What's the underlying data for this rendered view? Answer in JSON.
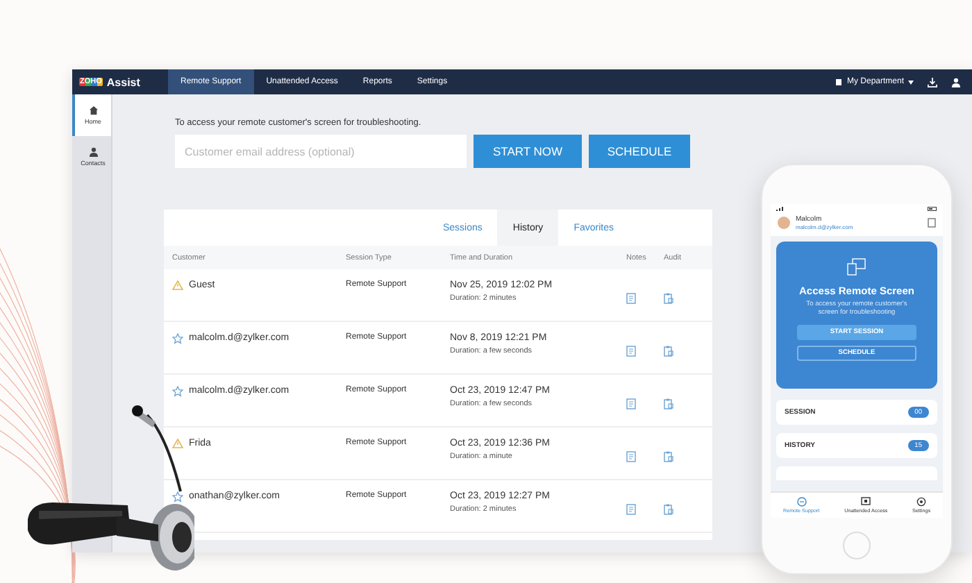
{
  "app": {
    "logo": {
      "brand": "ZOHO",
      "product": "Assist"
    },
    "nav": [
      {
        "label": "Remote Support",
        "selected": true
      },
      {
        "label": "Unattended Access",
        "selected": false
      },
      {
        "label": "Reports",
        "selected": false
      },
      {
        "label": "Settings",
        "selected": false
      }
    ],
    "department": "My Department",
    "sidebar": [
      {
        "label": "Home",
        "selected": true
      },
      {
        "label": "Contacts",
        "selected": false
      }
    ],
    "prompt": "To access your remote customer's screen for troubleshooting.",
    "email_field": {
      "placeholder": "Customer email address (optional)"
    },
    "buttons": [
      "START NOW",
      "SCHEDULE"
    ],
    "tabs": [
      {
        "label": "Sessions",
        "selected": false
      },
      {
        "label": "History",
        "selected": true
      },
      {
        "label": "Favorites",
        "selected": false
      }
    ],
    "columns": [
      "Customer",
      "Session Type",
      "Time and Duration",
      "Notes",
      "Audit"
    ],
    "rows": [
      {
        "kind": "warning",
        "customer": "Guest",
        "type": "Remote Support",
        "time": "Nov 25, 2019 12:02 PM",
        "duration": "Duration: 2 minutes"
      },
      {
        "kind": "star",
        "customer": "malcolm.d@zylker.com",
        "type": "Remote Support",
        "time": "Nov 8, 2019 12:21 PM",
        "duration": "Duration: a few seconds"
      },
      {
        "kind": "star",
        "customer": "malcolm.d@zylker.com",
        "type": "Remote Support",
        "time": "Oct 23, 2019 12:47 PM",
        "duration": "Duration: a few seconds"
      },
      {
        "kind": "warning",
        "customer": "Frida",
        "type": "Remote Support",
        "time": "Oct 23, 2019 12:36 PM",
        "duration": "Duration: a minute"
      },
      {
        "kind": "star",
        "customer": "onathan@zylker.com",
        "type": "Remote Support",
        "time": "Oct 23, 2019 12:27 PM",
        "duration": "Duration: 2 minutes"
      }
    ]
  },
  "phone": {
    "user": {
      "name": "Malcolm",
      "email": "malcolm.d@zylker.com"
    },
    "card": {
      "title": "Access Remote Screen",
      "text": "To access your remote customer's screen for troubleshooting",
      "buttons": [
        "START SESSION",
        "SCHEDULE"
      ]
    },
    "counts": [
      {
        "label": "SESSION",
        "count": "00"
      },
      {
        "label": "HISTORY",
        "count": "15"
      }
    ],
    "tabs": [
      {
        "label": "Remote Support",
        "selected": true
      },
      {
        "label": "Unattended Access",
        "selected": false
      },
      {
        "label": "Settings",
        "selected": false
      }
    ]
  }
}
